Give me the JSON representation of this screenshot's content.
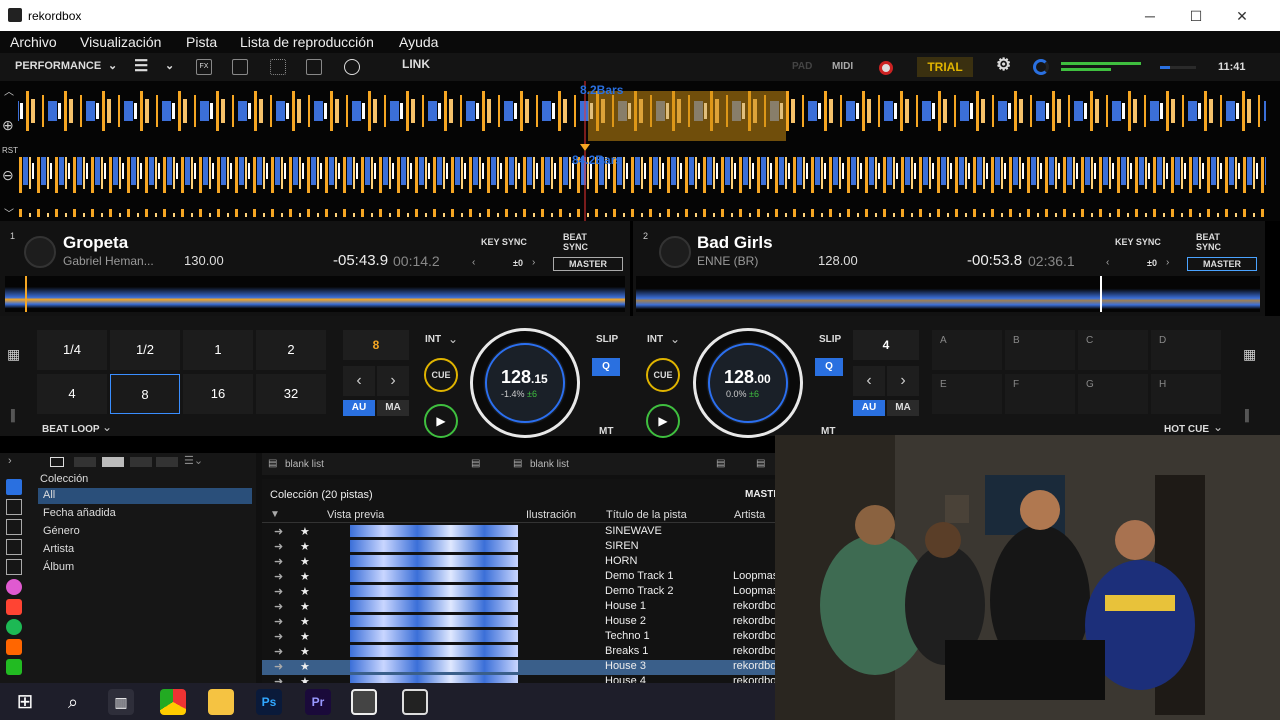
{
  "window": {
    "title": "rekordbox",
    "minimize": "─",
    "maximize": "☐",
    "close": "✕"
  },
  "menu": [
    "Archivo",
    "Visualización",
    "Pista",
    "Lista de reproducción",
    "Ayuda"
  ],
  "toolbar": {
    "mode": "PERFORMANCE",
    "link": "LINK",
    "pad": "PAD",
    "midi": "MIDI",
    "trial": "TRIAL",
    "clock": "11:41",
    "fx": "FX"
  },
  "wave": {
    "top_bars": "8.2Bars",
    "bottom_bars": "84.2Bars",
    "rst": "RST"
  },
  "deck1": {
    "num": "1",
    "title": "Gropeta",
    "artist": "Gabriel Heman...",
    "bpm": "130.00",
    "remain": "-05:43.9",
    "elapsed": "00:14.2",
    "key_sync": "KEY SYNC",
    "beat_sync": "BEAT\nSYNC",
    "key": "±0",
    "master": "MASTER"
  },
  "deck2": {
    "num": "2",
    "title": "Bad Girls",
    "artist": "ENNE (BR)",
    "bpm": "128.00",
    "remain": "-00:53.8",
    "elapsed": "02:36.1",
    "key_sync": "KEY SYNC",
    "beat_sync": "BEAT\nSYNC",
    "key": "±0",
    "master": "MASTER"
  },
  "perf1": {
    "loop_cells": [
      "1/4",
      "1/2",
      "1",
      "2",
      "4",
      "8",
      "16",
      "32"
    ],
    "loop_mode": "BEAT LOOP",
    "beat": "8",
    "int": "INT",
    "cue": "CUE",
    "slip": "SLIP",
    "q": "Q",
    "au": "AU",
    "ma": "MA",
    "mt": "MT",
    "jog_bpm": "128",
    "jog_bpm_dec": ".15",
    "jog_pitch": "-1.4%",
    "jog_range": "±6"
  },
  "perf2": {
    "beat": "4",
    "int": "INT",
    "cue": "CUE",
    "slip": "SLIP",
    "q": "Q",
    "au": "AU",
    "ma": "MA",
    "mt": "MT",
    "jog_bpm": "128",
    "jog_bpm_dec": ".00",
    "jog_pitch": "0.0%",
    "jog_range": "±6",
    "hot_cues": [
      "A",
      "B",
      "C",
      "D",
      "E",
      "F",
      "G",
      "H"
    ],
    "hot_mode": "HOT CUE"
  },
  "browser": {
    "tree_header": "Colección",
    "tree_items": [
      "All",
      "Fecha añadida",
      "Género",
      "Artista",
      "Álbum"
    ],
    "list1": "blank list",
    "list2": "blank list",
    "collection": "Colección (20 pistas)",
    "master_col": "MASTI",
    "cols": [
      "Vista previa",
      "Ilustración",
      "Título de la pista",
      "Artista"
    ],
    "rows": [
      {
        "title": "SINEWAVE",
        "artist": ""
      },
      {
        "title": "SIREN",
        "artist": ""
      },
      {
        "title": "HORN",
        "artist": ""
      },
      {
        "title": "Demo Track 1",
        "artist": "Loopmas"
      },
      {
        "title": "Demo Track 2",
        "artist": "Loopmas"
      },
      {
        "title": "House 1",
        "artist": "rekordbo"
      },
      {
        "title": "House 2",
        "artist": "rekordbo"
      },
      {
        "title": "Techno 1",
        "artist": "rekordbo"
      },
      {
        "title": "Breaks 1",
        "artist": "rekordbo"
      },
      {
        "title": "House 3",
        "artist": "rekordbo"
      },
      {
        "title": "House 4",
        "artist": "rekordbo"
      }
    ]
  },
  "taskbar": [
    "windows-start",
    "search",
    "task-view",
    "chrome",
    "file-explorer",
    "photoshop",
    "premiere",
    "rekordbox",
    "app"
  ],
  "taskbar_labels": {
    "ps": "Ps",
    "pr": "Pr"
  },
  "colors": {
    "accent": "#2a70e0",
    "trial": "#e0b400",
    "wave_orange": "#f5a623",
    "wave_blue": "#3b6fd8"
  }
}
